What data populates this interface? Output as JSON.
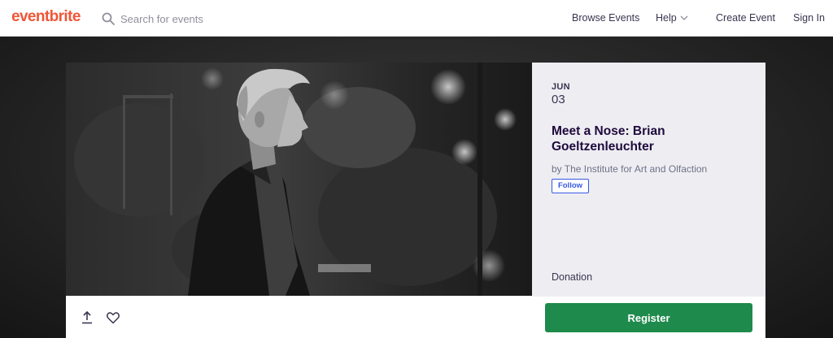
{
  "nav": {
    "logo": "eventbrite",
    "search_placeholder": "Search for events",
    "browse_events": "Browse Events",
    "help": "Help",
    "create_event": "Create Event",
    "sign_in": "Sign In",
    "icons": [
      "search-icon",
      "chevron-down-icon"
    ]
  },
  "event": {
    "date_month": "JUN",
    "date_day": "03",
    "title": "Meet a Nose: Brian Goeltzenleuchter",
    "organizer": "by The Institute for Art and Olfaction",
    "follow_label": "Follow",
    "price": "Donation"
  },
  "actions": {
    "register_label": "Register",
    "icons": [
      "share-icon",
      "heart-icon"
    ]
  },
  "colors": {
    "brand": "#f05537",
    "register": "#1e8a4c",
    "follow": "#3659e3",
    "panel": "#eeedf2"
  }
}
